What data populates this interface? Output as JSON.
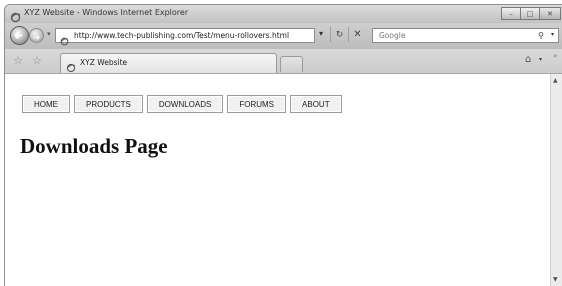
{
  "window": {
    "title": "XYZ Website - Windows Internet Explorer"
  },
  "address_bar": {
    "url": "http://www.tech-publishing.com/Test/menu-rollovers.html",
    "search_placeholder": "Google"
  },
  "tabs": [
    {
      "label": "XYZ Website"
    }
  ],
  "page": {
    "menu": [
      {
        "label": "HOME"
      },
      {
        "label": "PRODUCTS"
      },
      {
        "label": "DOWNLOADS"
      },
      {
        "label": "FORUMS"
      },
      {
        "label": "ABOUT"
      }
    ],
    "heading": "Downloads Page"
  }
}
